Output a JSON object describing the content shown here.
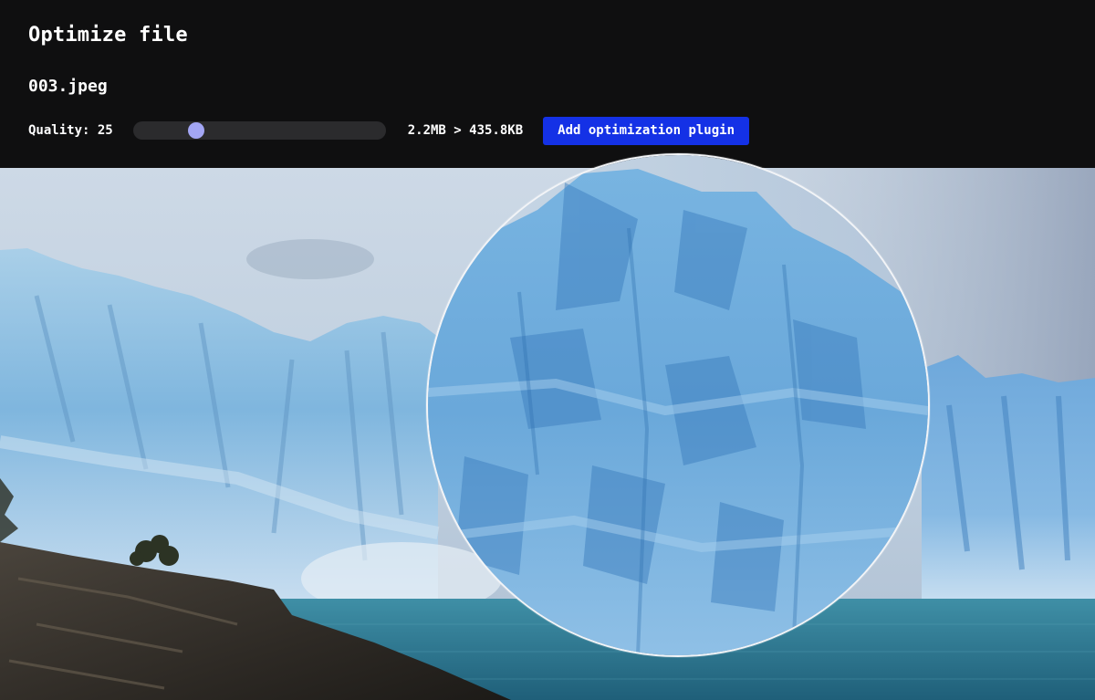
{
  "app": {
    "title": "Optimize file",
    "filename": "003.jpeg"
  },
  "controls": {
    "quality_label": "Quality: 25",
    "quality_value": 25,
    "quality_min": 0,
    "quality_max": 100,
    "size_comparison": "2.2MB > 435.8KB",
    "plugin_button_label": "Add optimization plugin"
  },
  "colors": {
    "header_bg": "#0f0f10",
    "accent_button": "#1431e6",
    "slider_thumb": "#a3a6f4",
    "slider_track": "#2b2b2d"
  },
  "preview": {
    "subject": "glacier photo with magnifier lens",
    "lens_icon": "magnifier-lens"
  }
}
